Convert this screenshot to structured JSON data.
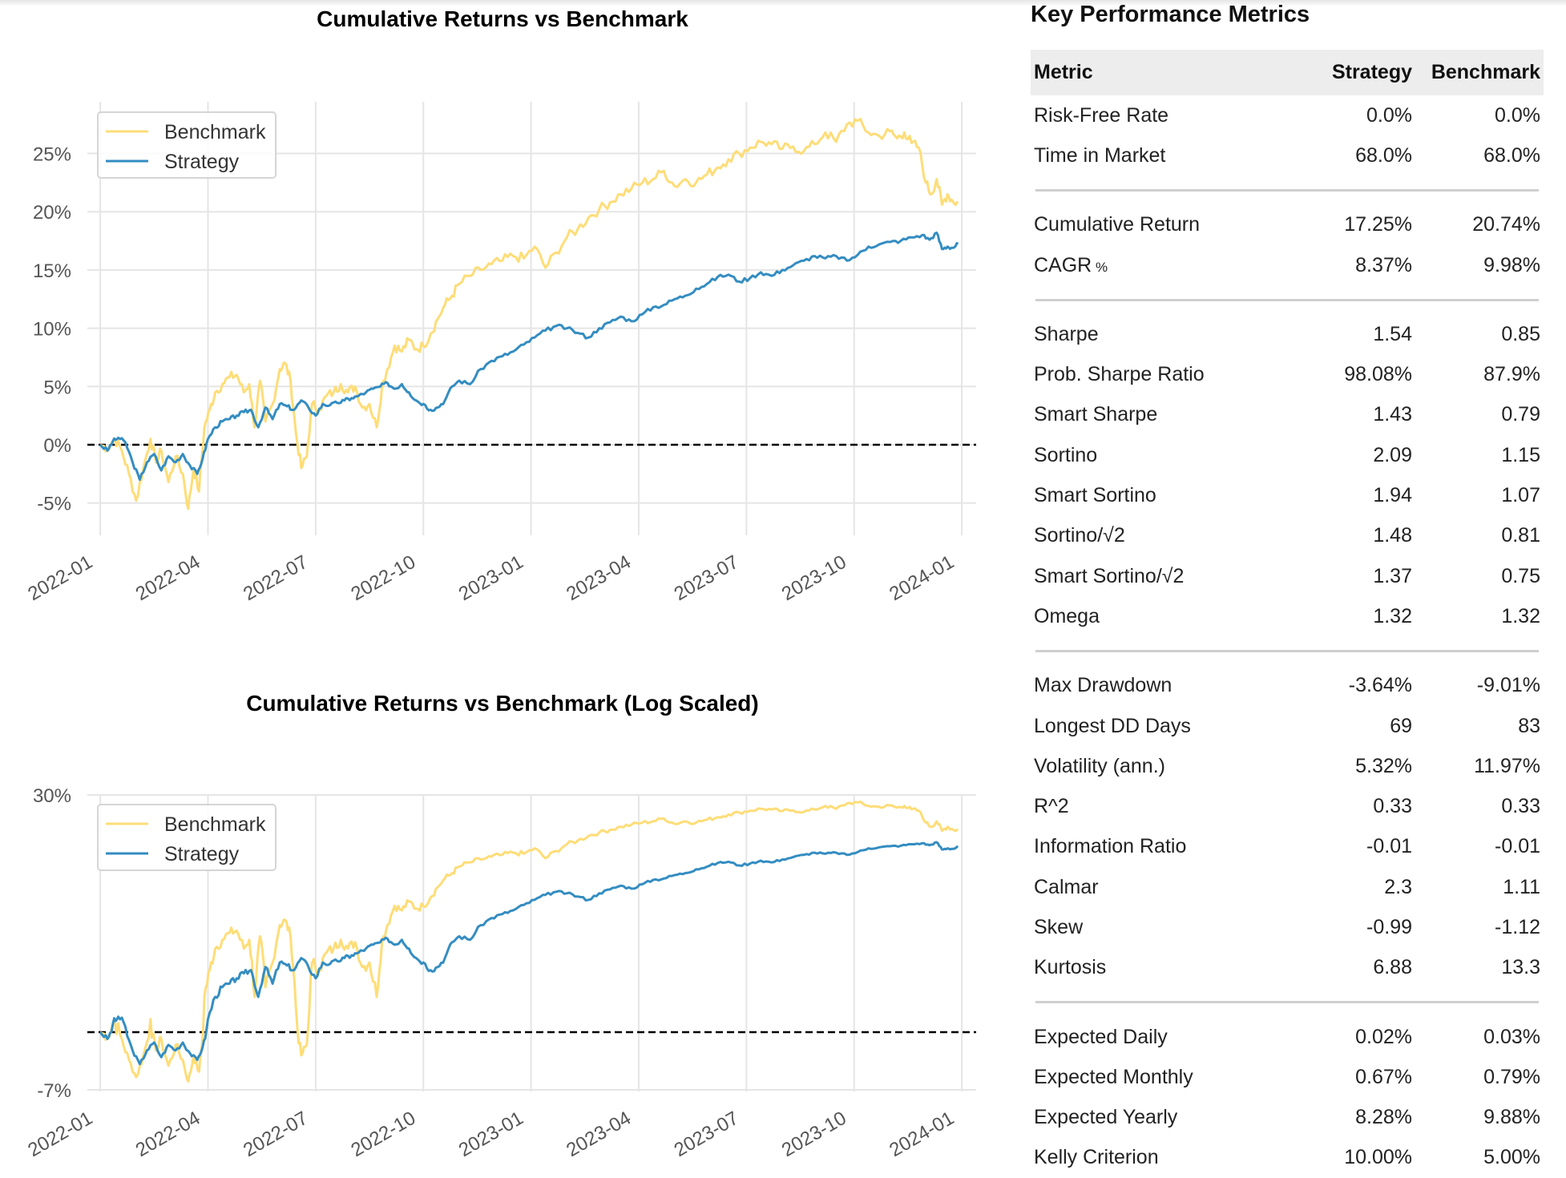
{
  "colors": {
    "benchmark": "#fedd78",
    "strategy": "#348dc1",
    "grid": "#e5e5e5",
    "zero_line": "#000000",
    "header_bg": "#ededed",
    "separator": "#cfcfcf"
  },
  "metrics": {
    "title": "Key Performance Metrics",
    "columns": [
      "Metric",
      "Strategy",
      "Benchmark"
    ],
    "groups": [
      [
        {
          "metric": "Risk-Free Rate",
          "strategy": "0.0%",
          "benchmark": "0.0%"
        },
        {
          "metric": "Time in Market",
          "strategy": "68.0%",
          "benchmark": "68.0%"
        }
      ],
      [
        {
          "metric": "Cumulative Return",
          "strategy": "17.25%",
          "benchmark": "20.74%"
        },
        {
          "metric": "CAGR",
          "metric_suffix": "%",
          "strategy": "8.37%",
          "benchmark": "9.98%"
        }
      ],
      [
        {
          "metric": "Sharpe",
          "strategy": "1.54",
          "benchmark": "0.85"
        },
        {
          "metric": "Prob. Sharpe Ratio",
          "strategy": "98.08%",
          "benchmark": "87.9%"
        },
        {
          "metric": "Smart Sharpe",
          "strategy": "1.43",
          "benchmark": "0.79"
        },
        {
          "metric": "Sortino",
          "strategy": "2.09",
          "benchmark": "1.15"
        },
        {
          "metric": "Smart Sortino",
          "strategy": "1.94",
          "benchmark": "1.07"
        },
        {
          "metric": "Sortino/√2",
          "strategy": "1.48",
          "benchmark": "0.81"
        },
        {
          "metric": "Smart Sortino/√2",
          "strategy": "1.37",
          "benchmark": "0.75"
        },
        {
          "metric": "Omega",
          "strategy": "1.32",
          "benchmark": "1.32"
        }
      ],
      [
        {
          "metric": "Max Drawdown",
          "strategy": "-3.64%",
          "benchmark": "-9.01%"
        },
        {
          "metric": "Longest DD Days",
          "strategy": "69",
          "benchmark": "83"
        },
        {
          "metric": "Volatility (ann.)",
          "strategy": "5.32%",
          "benchmark": "11.97%"
        },
        {
          "metric": "R^2",
          "strategy": "0.33",
          "benchmark": "0.33"
        },
        {
          "metric": "Information Ratio",
          "strategy": "-0.01",
          "benchmark": "-0.01"
        },
        {
          "metric": "Calmar",
          "strategy": "2.3",
          "benchmark": "1.11"
        },
        {
          "metric": "Skew",
          "strategy": "-0.99",
          "benchmark": "-1.12"
        },
        {
          "metric": "Kurtosis",
          "strategy": "6.88",
          "benchmark": "13.3"
        }
      ],
      [
        {
          "metric": "Expected Daily",
          "strategy": "0.02%",
          "benchmark": "0.03%"
        },
        {
          "metric": "Expected Monthly",
          "strategy": "0.67%",
          "benchmark": "0.79%"
        },
        {
          "metric": "Expected Yearly",
          "strategy": "8.28%",
          "benchmark": "9.88%"
        },
        {
          "metric": "Kelly Criterion",
          "strategy": "10.00%",
          "benchmark": "5.00%",
          "clipped": true
        }
      ]
    ]
  },
  "chart_data": [
    {
      "type": "line",
      "title": "Cumulative Returns vs Benchmark",
      "xlabel": "",
      "ylabel": "",
      "x_ticks": [
        "2022-01",
        "2022-04",
        "2022-07",
        "2022-10",
        "2023-01",
        "2023-04",
        "2023-07",
        "2023-10",
        "2024-01"
      ],
      "y_ticks": [
        "-5%",
        "0%",
        "5%",
        "10%",
        "15%",
        "20%",
        "25%"
      ],
      "y_tick_values": [
        -5,
        0,
        5,
        10,
        15,
        20,
        25
      ],
      "ylim": [
        -7.7,
        28.8
      ],
      "xlim_months": [
        -0.36,
        24.4
      ],
      "y_scale": "linear",
      "grid": true,
      "zero_line": true,
      "legend": {
        "position": "top-left",
        "entries": [
          "Benchmark",
          "Strategy"
        ]
      },
      "x_unit": "months since 2022-01-01",
      "series": [
        {
          "name": "Benchmark",
          "x": [
            0.2,
            0.4,
            0.6,
            0.8,
            1.0,
            1.2,
            1.4,
            1.55,
            1.7,
            1.9,
            2.1,
            2.3,
            2.45,
            2.6,
            2.75,
            2.9,
            3.05,
            3.2,
            3.4,
            3.6,
            3.8,
            4.0,
            4.15,
            4.3,
            4.45,
            4.6,
            4.8,
            5.0,
            5.15,
            5.3,
            5.45,
            5.6,
            5.75,
            5.9,
            6.1,
            6.3,
            6.5,
            6.7,
            6.9,
            7.1,
            7.3,
            7.5,
            7.7,
            7.85,
            8.0,
            8.2,
            8.4,
            8.6,
            8.8,
            9.0,
            9.2,
            9.4,
            9.6,
            9.8,
            10.0,
            10.3,
            10.6,
            10.9,
            11.2,
            11.5,
            11.8,
            12.1,
            12.4,
            12.7,
            13.0,
            13.3,
            13.6,
            13.9,
            14.2,
            14.5,
            14.8,
            15.1,
            15.4,
            15.7,
            16.0,
            16.3,
            16.6,
            16.9,
            17.2,
            17.5,
            17.8,
            18.1,
            18.4,
            18.7,
            19.0,
            19.3,
            19.6,
            19.9,
            20.2,
            20.5,
            20.8,
            21.1,
            21.4,
            21.7,
            22.0,
            22.2,
            22.4,
            22.6,
            22.8,
            23.0,
            23.15,
            23.3,
            23.45,
            23.6,
            23.75,
            23.9
          ],
          "values": [
            -0.3,
            0.5,
            -0.5,
            -2.5,
            -4.8,
            -2.0,
            0.5,
            -1.5,
            -0.5,
            -3.2,
            -1.0,
            -2.5,
            -5.5,
            -2.0,
            -4.0,
            1.5,
            3.0,
            4.5,
            5.2,
            5.8,
            6.0,
            4.5,
            5.2,
            1.5,
            5.5,
            2.0,
            3.5,
            6.5,
            7.0,
            5.5,
            1.0,
            -2.0,
            -1.0,
            3.5,
            3.0,
            4.2,
            4.5,
            5.2,
            4.5,
            5.0,
            3.2,
            3.5,
            1.5,
            5.0,
            6.5,
            8.5,
            8.0,
            9.0,
            8.2,
            8.5,
            9.5,
            10.8,
            12.0,
            12.8,
            13.8,
            14.5,
            15.0,
            15.5,
            15.8,
            16.2,
            16.0,
            17.0,
            15.2,
            16.5,
            17.8,
            18.5,
            19.5,
            20.2,
            20.8,
            21.5,
            22.0,
            22.5,
            22.8,
            23.5,
            22.2,
            22.8,
            22.5,
            23.2,
            23.8,
            24.5,
            25.0,
            25.5,
            26.0,
            25.8,
            25.4,
            25.6,
            25.2,
            25.8,
            26.8,
            26.0,
            27.5,
            27.8,
            26.8,
            26.5,
            26.9,
            26.3,
            26.8,
            25.9,
            25.5,
            22.5,
            21.5,
            22.8,
            20.6,
            21.5,
            20.9,
            20.74
          ]
        },
        {
          "name": "Strategy",
          "x": [
            0.2,
            0.35,
            0.5,
            0.7,
            0.9,
            1.1,
            1.3,
            1.5,
            1.7,
            1.9,
            2.1,
            2.3,
            2.5,
            2.7,
            2.85,
            3.0,
            3.2,
            3.4,
            3.6,
            3.8,
            4.0,
            4.2,
            4.4,
            4.6,
            4.8,
            5.0,
            5.2,
            5.4,
            5.6,
            5.8,
            6.0,
            6.2,
            6.4,
            6.6,
            6.8,
            7.0,
            7.2,
            7.4,
            7.6,
            7.8,
            8.0,
            8.2,
            8.4,
            8.6,
            8.8,
            9.0,
            9.2,
            9.4,
            9.6,
            9.8,
            10.0,
            10.3,
            10.6,
            10.9,
            11.2,
            11.5,
            11.8,
            12.1,
            12.4,
            12.7,
            13.0,
            13.3,
            13.6,
            13.9,
            14.2,
            14.5,
            14.8,
            15.1,
            15.4,
            15.7,
            16.0,
            16.3,
            16.6,
            16.9,
            17.2,
            17.5,
            17.8,
            18.1,
            18.4,
            18.7,
            19.0,
            19.3,
            19.6,
            19.9,
            20.2,
            20.5,
            20.8,
            21.1,
            21.4,
            21.7,
            22.0,
            22.3,
            22.6,
            22.9,
            23.1,
            23.3,
            23.45,
            23.6,
            23.75,
            23.9
          ],
          "values": [
            -0.5,
            0.3,
            0.6,
            0.2,
            -1.5,
            -3.0,
            -1.5,
            -0.8,
            -2.2,
            -1.0,
            -1.5,
            -0.8,
            -1.8,
            -2.5,
            -1.2,
            0.5,
            1.5,
            2.0,
            2.2,
            2.5,
            2.8,
            3.0,
            1.5,
            3.2,
            2.2,
            3.5,
            3.3,
            3.0,
            3.8,
            3.2,
            2.5,
            3.5,
            3.4,
            3.6,
            3.8,
            4.0,
            4.2,
            4.5,
            4.8,
            5.0,
            5.3,
            4.8,
            5.2,
            4.5,
            3.8,
            3.5,
            3.0,
            3.2,
            3.8,
            5.0,
            5.5,
            5.2,
            6.5,
            7.2,
            7.6,
            8.0,
            8.6,
            9.2,
            9.8,
            10.2,
            10.0,
            9.6,
            9.2,
            10.0,
            10.5,
            11.0,
            10.6,
            11.2,
            11.8,
            12.0,
            12.5,
            12.8,
            13.4,
            13.8,
            14.4,
            14.6,
            14.0,
            14.3,
            14.8,
            14.5,
            15.0,
            15.4,
            15.8,
            16.2,
            16.0,
            16.2,
            15.8,
            16.3,
            17.0,
            17.2,
            17.4,
            17.5,
            17.8,
            18.0,
            17.6,
            18.2,
            16.8,
            17.0,
            16.9,
            17.25
          ]
        }
      ]
    },
    {
      "type": "line",
      "title": "Cumulative Returns vs Benchmark (Log Scaled)",
      "xlabel": "",
      "ylabel": "",
      "x_ticks": [
        "2022-01",
        "2022-04",
        "2022-07",
        "2022-10",
        "2023-01",
        "2023-04",
        "2023-07",
        "2023-10",
        "2024-01"
      ],
      "y_ticks": [
        "-7%",
        "30%"
      ],
      "y_tick_values": [
        -7,
        30
      ],
      "ylim": [
        -7,
        30
      ],
      "xlim_months": [
        -0.36,
        24.4
      ],
      "y_scale": "symlog",
      "grid": true,
      "zero_line": true,
      "legend": {
        "position": "top-left",
        "entries": [
          "Benchmark",
          "Strategy"
        ]
      },
      "series_ref": "same data as chart 0"
    }
  ]
}
